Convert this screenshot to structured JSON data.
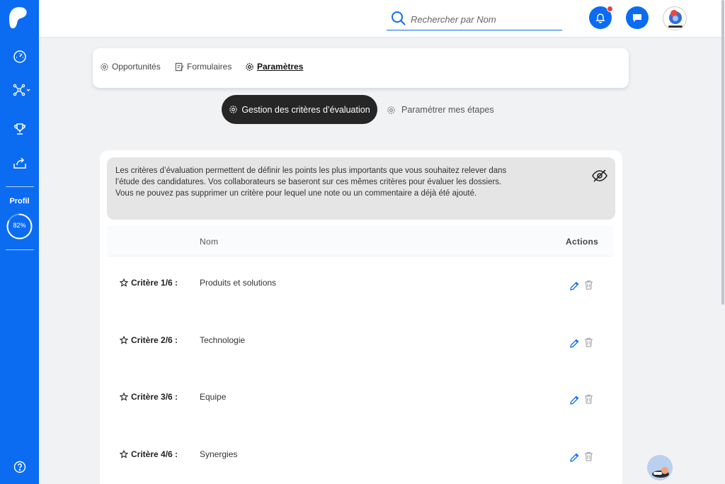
{
  "sidebar": {
    "profile_label": "Profil",
    "profile_percent_text": "82%",
    "profile_progress": 82,
    "items": [
      {
        "name": "dashboard-icon"
      },
      {
        "name": "network-icon"
      },
      {
        "name": "trophy-icon"
      },
      {
        "name": "share-upload-icon"
      }
    ],
    "help_icon": "help-circle-icon"
  },
  "header": {
    "search_placeholder": "Rechercher par Nom",
    "notifications_icon": "bell-icon",
    "messages_icon": "chat-icon"
  },
  "tabs": [
    {
      "label": "Opportunités",
      "icon": "gear-icon",
      "active": false
    },
    {
      "label": "Formulaires",
      "icon": "edit-form-icon",
      "active": false
    },
    {
      "label": "Paramètres",
      "icon": "gear-icon",
      "active": true
    }
  ],
  "subtabs": {
    "active_label": "Gestion des critères d’évaluation",
    "other_label": "Paramétrer mes étapes"
  },
  "info": {
    "text": "Les critères d’évaluation permettent de définir les points les plus importants que vous souhaitez relever dans l’étude des candidatures. Vos collaborateurs se baseront sur ces mêmes critères pour évaluer les dossiers. Vous ne pouvez pas supprimer un critère pour lequel une note ou un commentaire a déjà été ajouté."
  },
  "table": {
    "columns": {
      "nom": "Nom",
      "actions": "Actions"
    },
    "rows": [
      {
        "label": "Critère 1/6 :",
        "name": "Produits et solutions"
      },
      {
        "label": "Critère 2/6 :",
        "name": "Technologie"
      },
      {
        "label": "Critère 3/6 :",
        "name": "Equipe"
      },
      {
        "label": "Critère 4/6 :",
        "name": "Synergies"
      }
    ]
  },
  "colors": {
    "primary": "#0b6cf2",
    "dark_pill": "#262626",
    "notification_dot": "#ef3e36"
  }
}
